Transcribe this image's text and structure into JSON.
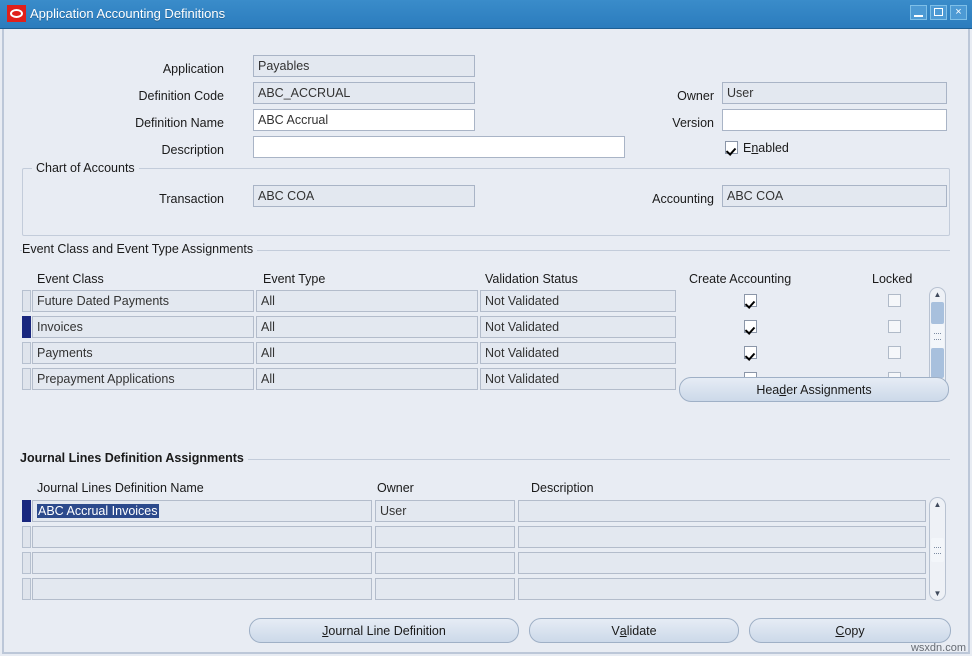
{
  "window": {
    "title": "Application Accounting Definitions",
    "logo_icon": "oracle-logo-icon",
    "minimize_label": "",
    "maximize_label": "",
    "close_label": "×"
  },
  "header_form": {
    "application": {
      "label": "Application",
      "value": "Payables",
      "readonly": true
    },
    "definition_code": {
      "label": "Definition Code",
      "value": "ABC_ACCRUAL",
      "readonly": true
    },
    "definition_name": {
      "label": "Definition Name",
      "value": "ABC Accrual",
      "readonly": false
    },
    "description": {
      "label": "Description",
      "value": "",
      "readonly": false
    },
    "owner": {
      "label": "Owner",
      "value": "User",
      "readonly": true
    },
    "version": {
      "label": "Version",
      "value": "",
      "readonly": false
    },
    "enabled": {
      "label_before": "E",
      "label_mnemonic": "n",
      "label_after": "abled",
      "checked": true
    }
  },
  "chart_of_accounts": {
    "title": "Chart of Accounts",
    "transaction": {
      "label": "Transaction",
      "value": "ABC COA"
    },
    "accounting": {
      "label": "Accounting",
      "value": "ABC COA"
    }
  },
  "event_section": {
    "title": "Event Class and Event Type Assignments",
    "columns": [
      "Event Class",
      "Event Type",
      "Validation Status",
      "Create Accounting",
      "Locked"
    ],
    "rows": [
      {
        "event_class": "Future Dated Payments",
        "event_type": "All",
        "validation_status": "Not Validated",
        "create_accounting": true,
        "locked": false,
        "current": false
      },
      {
        "event_class": "Invoices",
        "event_type": "All",
        "validation_status": "Not Validated",
        "create_accounting": true,
        "locked": false,
        "current": true
      },
      {
        "event_class": "Payments",
        "event_type": "All",
        "validation_status": "Not Validated",
        "create_accounting": true,
        "locked": false,
        "current": false
      },
      {
        "event_class": "Prepayment Applications",
        "event_type": "All",
        "validation_status": "Not Validated",
        "create_accounting": true,
        "locked": false,
        "current": false
      }
    ],
    "header_assignments_button": {
      "before": "Hea",
      "mnemonic": "d",
      "after": "er Assignments"
    }
  },
  "journal_section": {
    "title": "Journal Lines Definition Assignments",
    "columns": [
      "Journal Lines Definition Name",
      "Owner",
      "Description"
    ],
    "rows": [
      {
        "name": "ABC Accrual Invoices",
        "owner": "User",
        "description": "",
        "current": true,
        "selected_text": true
      },
      {
        "name": "",
        "owner": "",
        "description": "",
        "current": false,
        "selected_text": false
      },
      {
        "name": "",
        "owner": "",
        "description": "",
        "current": false,
        "selected_text": false
      },
      {
        "name": "",
        "owner": "",
        "description": "",
        "current": false,
        "selected_text": false
      }
    ]
  },
  "footer_buttons": [
    {
      "before": "",
      "mnemonic": "J",
      "after": "ournal Line Definition"
    },
    {
      "before": "V",
      "mnemonic": "a",
      "after": "lidate"
    },
    {
      "before": "",
      "mnemonic": "C",
      "after": "opy"
    }
  ],
  "watermark": "wsxdn.com",
  "colors": {
    "titlebar": "#2b7cbd",
    "window_bg": "#e8ecf3",
    "field_readonly": "#e3e8f0",
    "field_editable": "#ffffff",
    "current_row_marker": "#19277e",
    "text_selection": "#2c4a8c",
    "oracle_red": "#e0201b"
  }
}
